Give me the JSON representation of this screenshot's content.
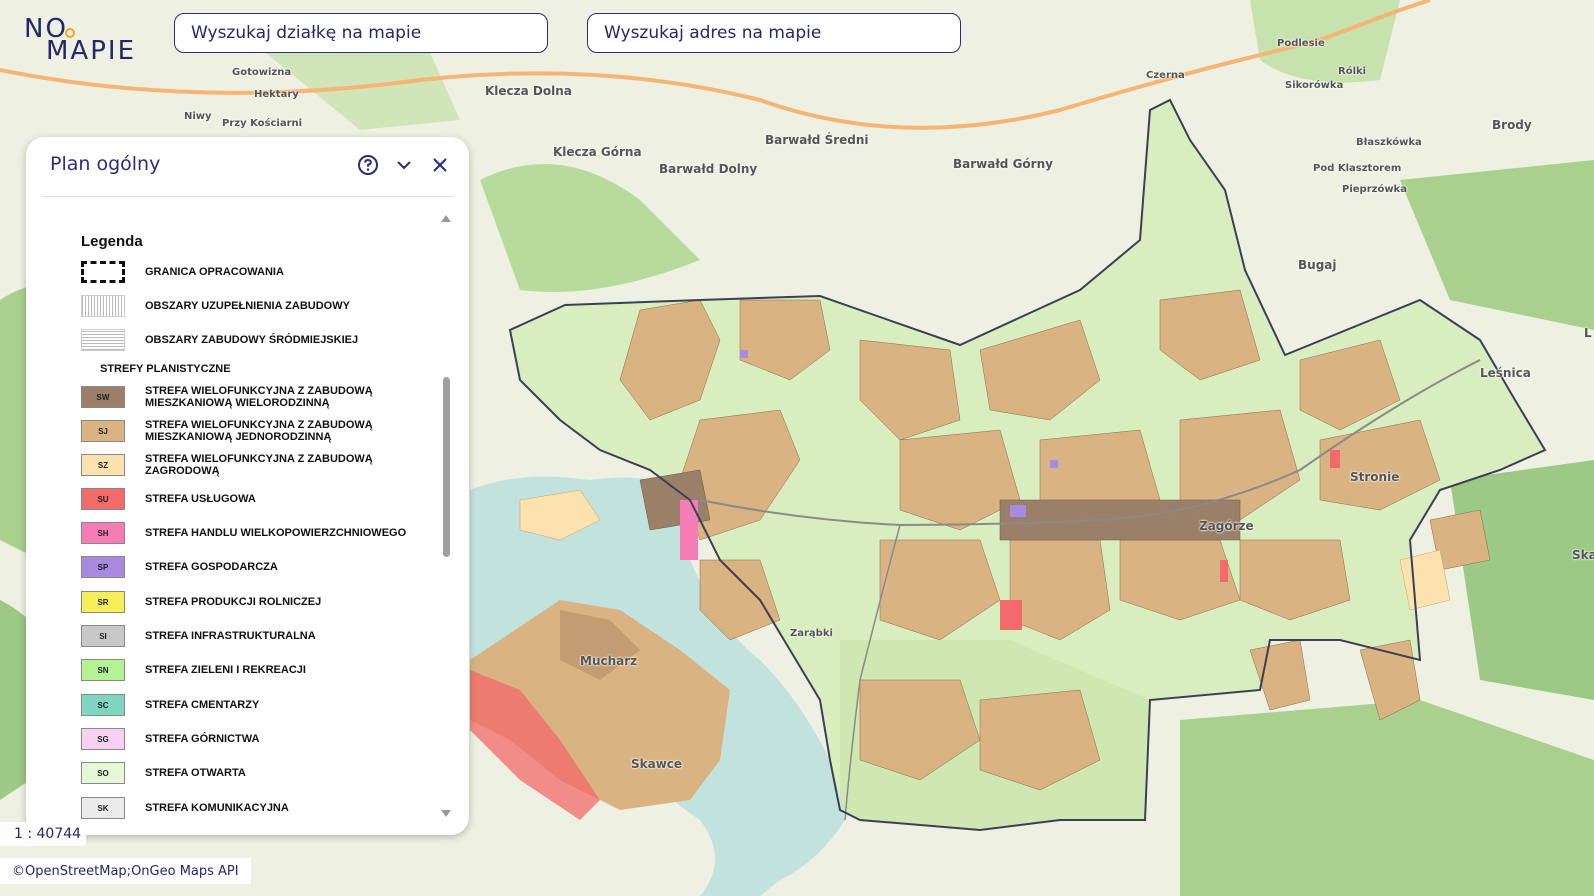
{
  "logo": {
    "line1": "NO",
    "line2": "MAPIE"
  },
  "search": {
    "plot_placeholder": "Wyszukaj działkę na mapie",
    "address_placeholder": "Wyszukaj adres na mapie"
  },
  "panel": {
    "title": "Plan ogólny",
    "legend_title": "Legenda",
    "boundary_label": "GRANICA OPRACOWANIA",
    "infill_label": "OBSZARY UZUPEŁNIENIA ZABUDOWY",
    "downtown_label": "OBSZARY ZABUDOWY ŚRÓDMIEJSKIEJ",
    "zones_heading": "STREFY PLANISTYCZNE",
    "zones": [
      {
        "code": "SW",
        "label": "STREFA WIELOFUNKCYJNA Z ZABUDOWĄ MIESZKANIOWĄ WIELORODZINNĄ",
        "color": "#9a8068"
      },
      {
        "code": "SJ",
        "label": "STREFA WIELOFUNKCYJNA Z ZABUDOWĄ MIESZKANIOWĄ JEDNORODZINNĄ",
        "color": "#d9b482"
      },
      {
        "code": "SZ",
        "label": "STREFA WIELOFUNKCYJNA Z ZABUDOWĄ ZAGRODOWĄ",
        "color": "#fbe2ae"
      },
      {
        "code": "SU",
        "label": "STREFA USŁUGOWA",
        "color": "#f26a6a"
      },
      {
        "code": "SH",
        "label": "STREFA HANDLU WIELKOPOWIERZCHNIOWEGO",
        "color": "#f57db5"
      },
      {
        "code": "SP",
        "label": "STREFA GOSPODARCZA",
        "color": "#a98ae0"
      },
      {
        "code": "SR",
        "label": "STREFA PRODUKCJI ROLNICZEJ",
        "color": "#f7ef5a"
      },
      {
        "code": "SI",
        "label": "STREFA INFRASTRUKTURALNA",
        "color": "#c8c8c8"
      },
      {
        "code": "SN",
        "label": "STREFA ZIELENI I REKREACJI",
        "color": "#b4f294"
      },
      {
        "code": "SC",
        "label": "STREFA CMENTARZY",
        "color": "#7fd6c0"
      },
      {
        "code": "SG",
        "label": "STREFA GÓRNICTWA",
        "color": "#f6d2f2"
      },
      {
        "code": "SO",
        "label": "STREFA OTWARTA",
        "color": "#e6f8d6"
      },
      {
        "code": "SK",
        "label": "STREFA KOMUNIKACYJNA",
        "color": "#ebebeb"
      }
    ]
  },
  "scale": {
    "text": "1 : 40744"
  },
  "attribution": {
    "osm": "©OpenStreetMap",
    "sep": ";",
    "ongeo": "OnGeo Maps API"
  },
  "map_labels": [
    {
      "text": "Klecza Dolna"
    },
    {
      "text": "Gotowizna"
    },
    {
      "text": "Hektary"
    },
    {
      "text": "Niwy"
    },
    {
      "text": "Przy Kościarni"
    },
    {
      "text": "Barwałd Średni"
    },
    {
      "text": "Klecza Górna"
    },
    {
      "text": "Barwałd Dolny"
    },
    {
      "text": "Barwałd Górny"
    },
    {
      "text": "Czerna"
    },
    {
      "text": "Podlesie"
    },
    {
      "text": "Rólki"
    },
    {
      "text": "Sikorówka"
    },
    {
      "text": "Brody"
    },
    {
      "text": "Błaszkówka"
    },
    {
      "text": "Pod Klasztorem"
    },
    {
      "text": "Pieprzówka"
    },
    {
      "text": "Bugaj"
    },
    {
      "text": "Leśnica"
    },
    {
      "text": "Stronie"
    },
    {
      "text": "Zagórze"
    },
    {
      "text": "Mucharz"
    },
    {
      "text": "Skawce"
    },
    {
      "text": "Zarąbki"
    },
    {
      "text": "Ska"
    },
    {
      "text": "L"
    }
  ],
  "colors": {
    "brand": "#2a2c7c",
    "lake": "#c2e2de",
    "terrain": "#dfeac8",
    "forest": "#8fc477"
  }
}
